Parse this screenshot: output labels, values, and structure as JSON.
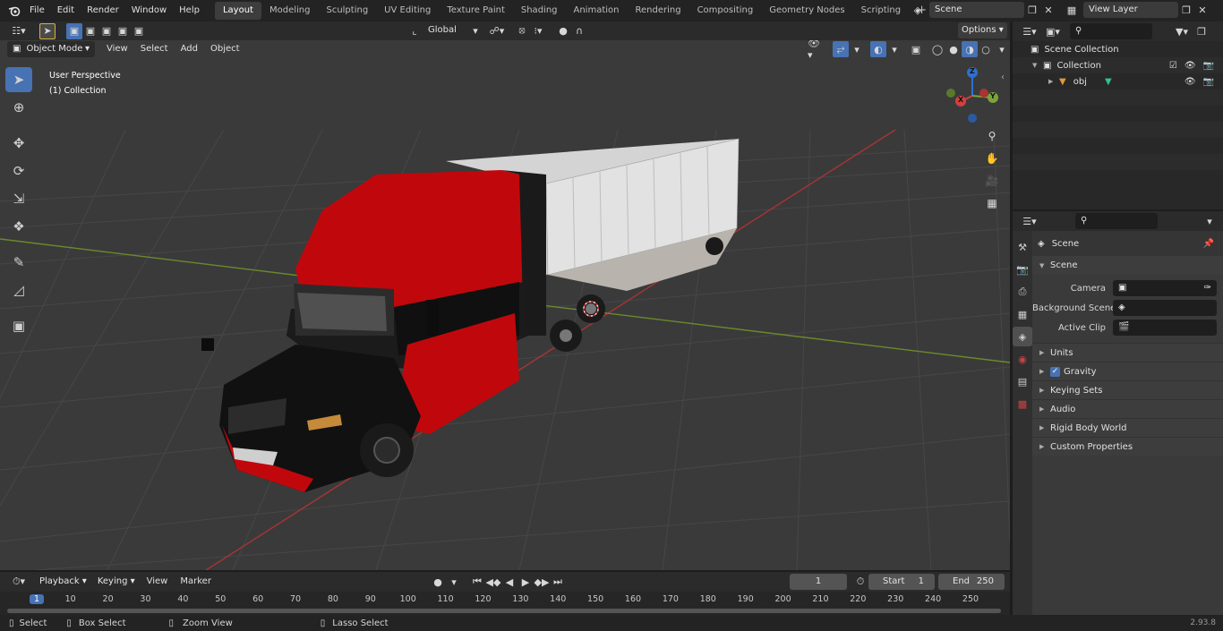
{
  "top_menu": [
    "File",
    "Edit",
    "Render",
    "Window",
    "Help"
  ],
  "workspace_tabs": [
    {
      "label": "Layout",
      "active": true
    },
    {
      "label": "Modeling",
      "active": false
    },
    {
      "label": "Sculpting",
      "active": false
    },
    {
      "label": "UV Editing",
      "active": false
    },
    {
      "label": "Texture Paint",
      "active": false
    },
    {
      "label": "Shading",
      "active": false
    },
    {
      "label": "Animation",
      "active": false
    },
    {
      "label": "Rendering",
      "active": false
    },
    {
      "label": "Compositing",
      "active": false
    },
    {
      "label": "Geometry Nodes",
      "active": false
    },
    {
      "label": "Scripting",
      "active": false
    }
  ],
  "add_workspace": "+",
  "scene_selector": "Scene",
  "view_layer_selector": "View Layer",
  "tool_header": {
    "transform_orientation": "Global",
    "options_label": "Options"
  },
  "viewport_header": {
    "mode": "Object Mode",
    "menus": [
      "View",
      "Select",
      "Add",
      "Object"
    ]
  },
  "viewport_overlay": {
    "perspective": "User Perspective",
    "collection": "(1) Collection"
  },
  "gizmo": {
    "x": "X",
    "y": "Y",
    "z": "Z"
  },
  "outliner": {
    "search_placeholder": "",
    "items": [
      {
        "label": "Scene Collection",
        "depth": 0
      },
      {
        "label": "Collection",
        "depth": 1
      },
      {
        "label": "obj",
        "depth": 2
      }
    ]
  },
  "properties": {
    "search_placeholder": "",
    "context": "Scene",
    "section": "Scene",
    "fields": [
      {
        "label": "Camera",
        "value": ""
      },
      {
        "label": "Background Scene",
        "value": ""
      },
      {
        "label": "Active Clip",
        "value": ""
      }
    ],
    "panels": [
      "Units",
      "Gravity",
      "Keying Sets",
      "Audio",
      "Rigid Body World",
      "Custom Properties"
    ]
  },
  "timeline": {
    "menus": [
      "Playback",
      "Keying",
      "View",
      "Marker"
    ],
    "current_frame": "1",
    "start_label": "Start",
    "start_value": "1",
    "end_label": "End",
    "end_value": "250",
    "ruler_ticks": [
      "1",
      "10",
      "20",
      "30",
      "40",
      "50",
      "60",
      "70",
      "80",
      "90",
      "100",
      "110",
      "120",
      "130",
      "140",
      "150",
      "160",
      "170",
      "180",
      "190",
      "200",
      "210",
      "220",
      "230",
      "240",
      "250"
    ]
  },
  "statusbar": {
    "items": [
      "Select",
      "Box Select",
      "Zoom View",
      "Lasso Select"
    ],
    "version": "2.93.8"
  },
  "colors": {
    "accent": "#4772b3",
    "truck_red": "#c0080c",
    "truck_black": "#151515",
    "trailer": "#d2d2d2",
    "grid": "#444444",
    "axis_red": "#b03434",
    "axis_green": "#6a8a2a"
  }
}
